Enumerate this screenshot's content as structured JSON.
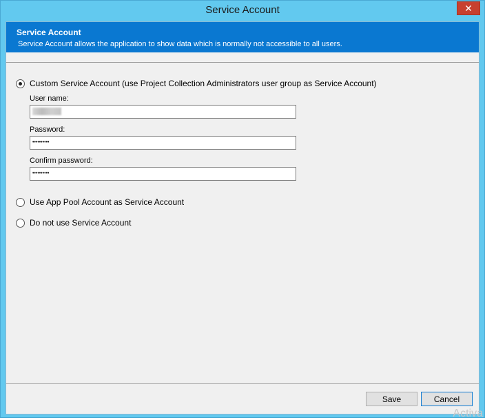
{
  "window": {
    "title": "Service Account",
    "close_label": "✕"
  },
  "banner": {
    "title": "Service Account",
    "description": "Service Account allows the application to show data which is normally not accessible to all users."
  },
  "options": {
    "custom": {
      "label": "Custom Service Account (use Project Collection Administrators user group as Service Account)",
      "selected": true
    },
    "app_pool": {
      "label": "Use App Pool Account as Service Account",
      "selected": false
    },
    "none": {
      "label": "Do not use Service Account",
      "selected": false
    }
  },
  "fields": {
    "username_label": "User name:",
    "password_label": "Password:",
    "password_value": "••••••••••",
    "confirm_label": "Confirm password:",
    "confirm_value": "••••••••••"
  },
  "buttons": {
    "save": "Save",
    "cancel": "Cancel"
  },
  "watermark": "Activa",
  "colors": {
    "titlebar": "#62c9ef",
    "banner": "#0a78d1",
    "close": "#c7402f"
  }
}
